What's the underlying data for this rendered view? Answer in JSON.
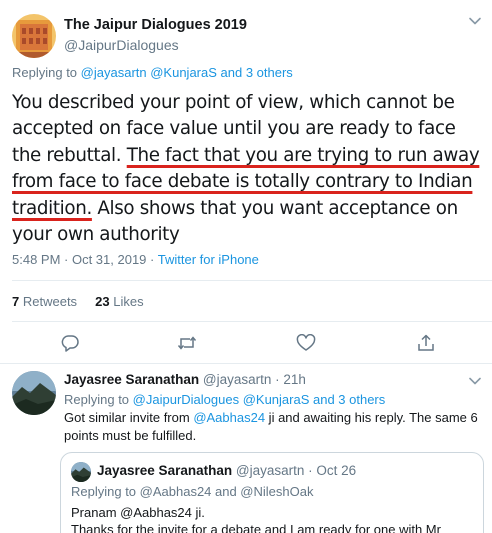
{
  "main_tweet": {
    "author_name": "The Jaipur Dialogues 2019",
    "author_handle": "@JaipurDialogues",
    "replying_prefix": "Replying to",
    "replying_mentions": "@jayasartn @KunjaraS and 3 others",
    "text_part1": "You described your point of view, which cannot be accepted on face value until you are ready to face the rebuttal. ",
    "text_underlined": "The fact that you are trying to run away from face to face debate is totally contrary to Indian tradition.",
    "text_part2": " Also shows that you want acceptance on your own authority",
    "timestamp": "5:48 PM · Oct 31, 2019 · ",
    "source": "Twitter for iPhone",
    "retweets_count": "7",
    "retweets_label": "Retweets",
    "likes_count": "23",
    "likes_label": "Likes"
  },
  "reply_tweet": {
    "author_name": "Jayasree Saranathan",
    "author_handle": "@jayasartn",
    "time": "· 21h",
    "replying_prefix": "Replying to",
    "replying_mentions": "@JaipurDialogues @KunjaraS and 3 others",
    "text_part1": "Got similar invite from ",
    "text_mention": "@Aabhas24",
    "text_part2": " ji and awaiting his reply. The same 6 points must be fulfilled."
  },
  "quoted_tweet": {
    "author_name": "Jayasree Saranathan",
    "author_handle": "@jayasartn",
    "time": "· Oct 26",
    "replying_text": "Replying to @Aabhas24 and @NileshOak",
    "line1": "Pranam @Aabhas24 ji.",
    "line2": "Thanks for the invite for a debate and I am ready for one with Mr"
  },
  "colors": {
    "link": "#1b95e0",
    "muted": "#657786",
    "underline": "#d9231d",
    "divider": "#e6ecf0"
  },
  "icons": [
    "chevron-down-icon",
    "reply-icon",
    "retweet-icon",
    "like-icon",
    "share-icon"
  ]
}
